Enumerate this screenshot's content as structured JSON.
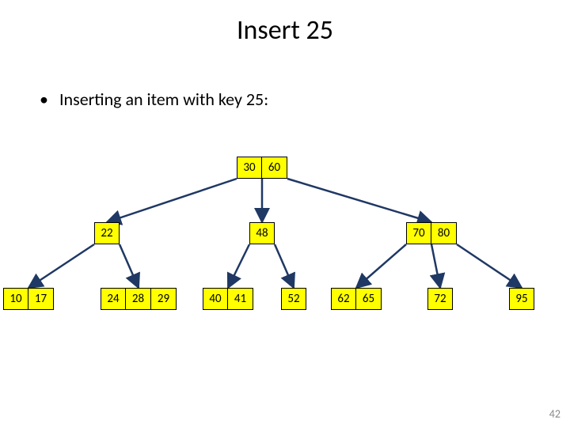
{
  "title": "Insert 25",
  "bullet": "Inserting an item with key 25:",
  "page_number": "42",
  "tree": {
    "root": {
      "keys": [
        "30",
        "60"
      ]
    },
    "level1": [
      {
        "keys": [
          "22"
        ]
      },
      {
        "keys": [
          "48"
        ]
      },
      {
        "keys": [
          "70",
          "80"
        ]
      }
    ],
    "level2": [
      {
        "keys": [
          "10",
          "17"
        ]
      },
      {
        "keys": [
          "24",
          "28",
          "29"
        ]
      },
      {
        "keys": [
          "40",
          "41"
        ]
      },
      {
        "keys": [
          "52"
        ]
      },
      {
        "keys": [
          "62",
          "65"
        ]
      },
      {
        "keys": [
          "72"
        ]
      },
      {
        "keys": [
          "95"
        ]
      }
    ]
  }
}
